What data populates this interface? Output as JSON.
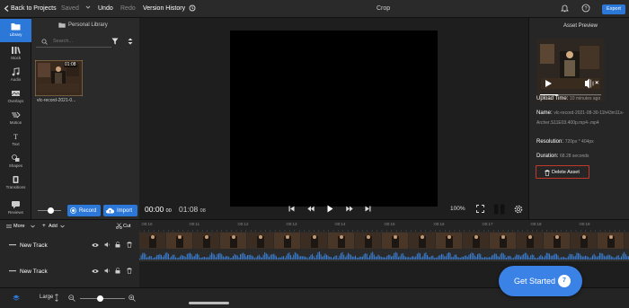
{
  "topbar": {
    "back_label": "Back to Projects",
    "saved_label": "Saved",
    "undo_label": "Undo",
    "redo_label": "Redo",
    "version_history_label": "Version History",
    "crop_label": "Crop",
    "export_label": "Export"
  },
  "nav": {
    "items": [
      {
        "label": "Library",
        "icon": "folder-icon",
        "active": true
      },
      {
        "label": "Stock",
        "icon": "stock-icon"
      },
      {
        "label": "Audio",
        "icon": "music-note-icon"
      },
      {
        "label": "Overlays",
        "icon": "overlays-icon"
      },
      {
        "label": "Motion",
        "icon": "motion-icon"
      },
      {
        "label": "Text",
        "icon": "text-icon"
      },
      {
        "label": "Shapes",
        "icon": "shapes-icon"
      },
      {
        "label": "Transitions",
        "icon": "transitions-icon"
      },
      {
        "label": "Reviews",
        "icon": "chat-icon"
      }
    ]
  },
  "library": {
    "title": "Personal Library",
    "search_placeholder": "Search...",
    "thumb_duration": "01:08",
    "thumb_name": "vlc-record-2021-0...",
    "record_label": "Record",
    "import_label": "Import"
  },
  "player": {
    "current_time": "00:00",
    "current_frames": "00",
    "total_time": "01:08",
    "total_frames": "08",
    "zoom": "100%"
  },
  "asset": {
    "title": "Asset Preview",
    "upload_label": "Upload Time:",
    "upload_value": "10 minutes ago",
    "name_label": "Name:",
    "name_value": "vlc-record-2021-08-30-11h43m11s-Archer.S11E03.400p.mp4-.mp4",
    "resolution_label": "Resolution:",
    "resolution_value": "720px * 404px",
    "duration_label": "Duration:",
    "duration_value": "68.28 seconds",
    "delete_label": "Delete Asset"
  },
  "timeline": {
    "more_label": "More",
    "add_label": "Add",
    "cut_label": "Cut",
    "tracks": [
      {
        "name": "New Track"
      },
      {
        "name": "New Track"
      }
    ],
    "ticks": [
      ":00:10",
      ":00:11",
      ":00:12",
      ":00:13",
      ":00:14",
      ":00:15",
      ":00:16",
      ":00:17",
      ":00:18",
      ":00:19"
    ],
    "size_label": "Large"
  },
  "cta": {
    "label": "Get Started",
    "badge": "7"
  },
  "colors": {
    "accent": "#2b78d9",
    "delete_border": "#c0392b",
    "waveform": "#3a7fd5"
  }
}
